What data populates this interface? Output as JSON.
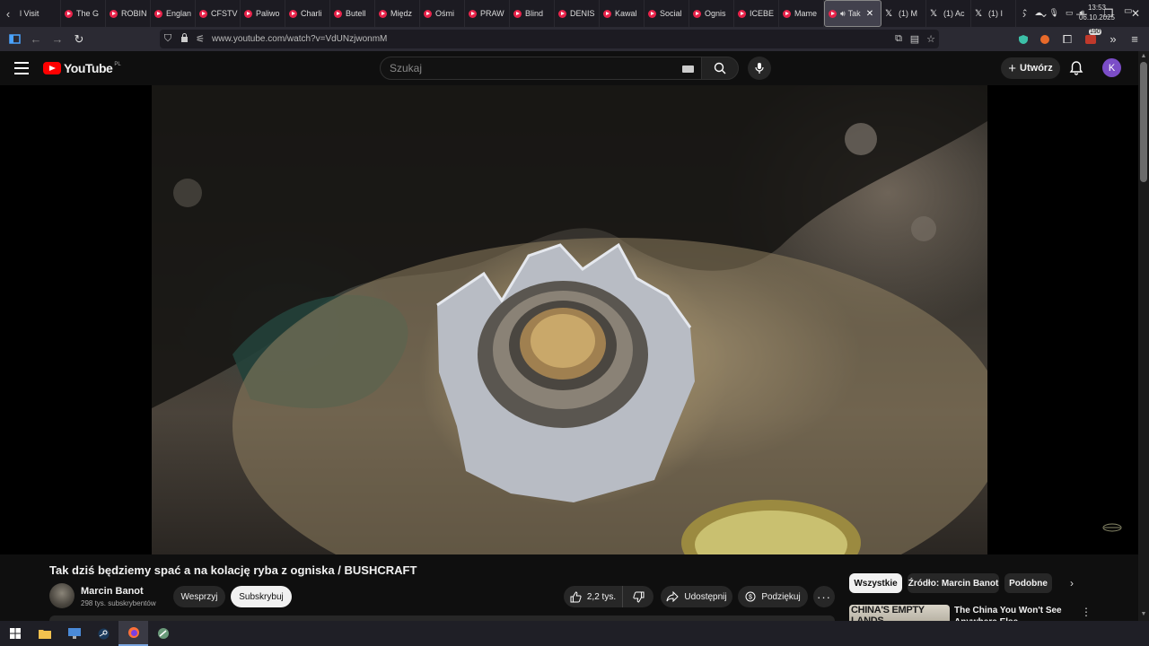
{
  "browser": {
    "tabs": [
      {
        "label": "l Visit",
        "type": "plain"
      },
      {
        "label": "The G",
        "type": "yt"
      },
      {
        "label": "ROBIN",
        "type": "yt"
      },
      {
        "label": "Englan",
        "type": "yt"
      },
      {
        "label": "CFSTV",
        "type": "yt"
      },
      {
        "label": "Paliwo",
        "type": "yt"
      },
      {
        "label": "Charli",
        "type": "yt"
      },
      {
        "label": "Butell",
        "type": "yt"
      },
      {
        "label": "Międz",
        "type": "yt"
      },
      {
        "label": "Ośmi",
        "type": "yt"
      },
      {
        "label": "PRAW",
        "type": "yt"
      },
      {
        "label": "Blind",
        "type": "yt"
      },
      {
        "label": "DENIS",
        "type": "yt"
      },
      {
        "label": "Kawal",
        "type": "yt"
      },
      {
        "label": "Social",
        "type": "yt"
      },
      {
        "label": "Ognis",
        "type": "yt"
      },
      {
        "label": "ICEBE",
        "type": "yt"
      },
      {
        "label": "Mame",
        "type": "yt"
      },
      {
        "label": "Tak",
        "type": "yt-active"
      },
      {
        "label": "(1) M",
        "type": "x"
      },
      {
        "label": "(1) Ac",
        "type": "x"
      },
      {
        "label": "(1) I",
        "type": "x"
      }
    ],
    "url": "www.youtube.com/watch?v=VdUNzjwonmM",
    "extension_badge": "190"
  },
  "youtube": {
    "logo_text": "YouTube",
    "region": "PL",
    "search_placeholder": "Szukaj",
    "create_label": "Utwórz",
    "avatar_letter": "K",
    "accent_color": "#ff0000"
  },
  "video": {
    "title": "Tak dziś będziemy spać a na kolację ryba z ogniska / BUSHCRAFT",
    "channel_name": "Marcin Banot",
    "subscribers": "298 tys. subskrybentów",
    "support_label": "Wesprzyj",
    "subscribe_label": "Subskrybuj",
    "likes": "2,2 tys.",
    "share_label": "Udostępnij",
    "thanks_label": "Podziękuj"
  },
  "sidebar": {
    "chips": [
      "Wszystkie",
      "Źródło: Marcin Banot",
      "Podobne"
    ],
    "recommendation": {
      "thumbnail_text": "CHINA'S EMPTY LANDS",
      "title": "The China You Won't See Anywhere Else"
    }
  },
  "taskbar": {
    "time": "13:53",
    "date": "06.10.2025"
  }
}
